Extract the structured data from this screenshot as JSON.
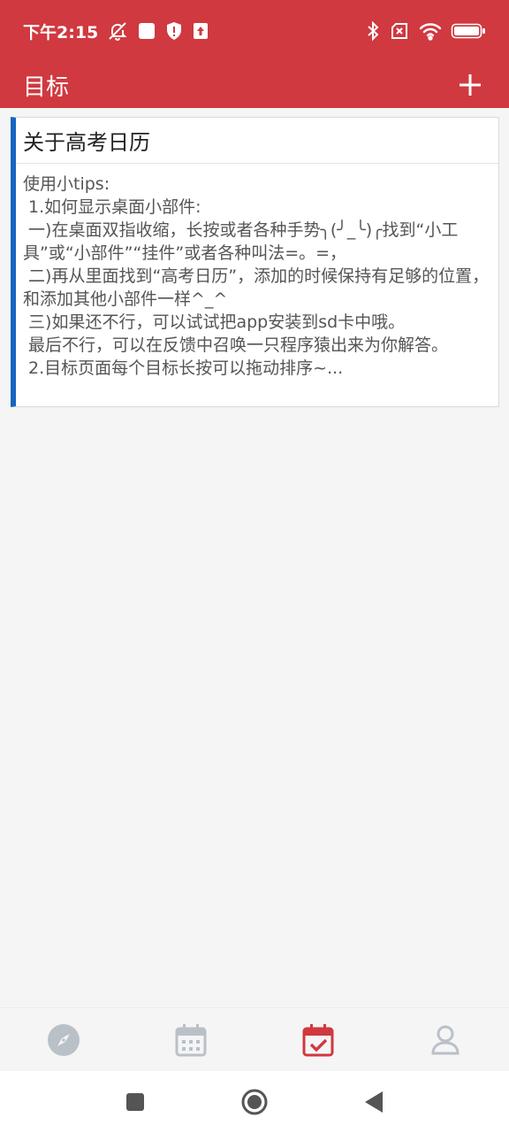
{
  "status_bar": {
    "time": "下午2:15",
    "battery": "100"
  },
  "app_bar": {
    "title": "目标",
    "add_icon": "plus-icon"
  },
  "goal_card": {
    "accent_color": "#1565c0",
    "title": "关于高考日历",
    "body": "使用小tips:\n 1.如何显示桌面小部件:\n 一)在桌面双指收缩，长按或者各种手势╮(╯_╰)╭找到“小工具”或“小部件”“挂件”或者各种叫法=。=，\n 二)再从里面找到“高考日历”，添加的时候保持有足够的位置，和添加其他小部件一样^_^\n 三)如果还不行，可以试试把app安装到sd卡中哦。\n 最后不行，可以在反馈中召唤一只程序猿出来为你解答。\n 2.目标页面每个目标长按可以拖动排序~..."
  },
  "tab_bar": {
    "tabs": [
      {
        "icon": "compass-icon",
        "active": false
      },
      {
        "icon": "calendar-icon",
        "active": false
      },
      {
        "icon": "calendar-check-icon",
        "active": true
      },
      {
        "icon": "person-icon",
        "active": false
      }
    ],
    "active_color": "#d0393f",
    "inactive_color": "#b9c0c8"
  },
  "system_nav": {
    "buttons": [
      "square-icon",
      "circle-home-icon",
      "back-triangle-icon"
    ]
  },
  "colors": {
    "brand_red": "#d0393f",
    "background": "#f5f5f5"
  }
}
